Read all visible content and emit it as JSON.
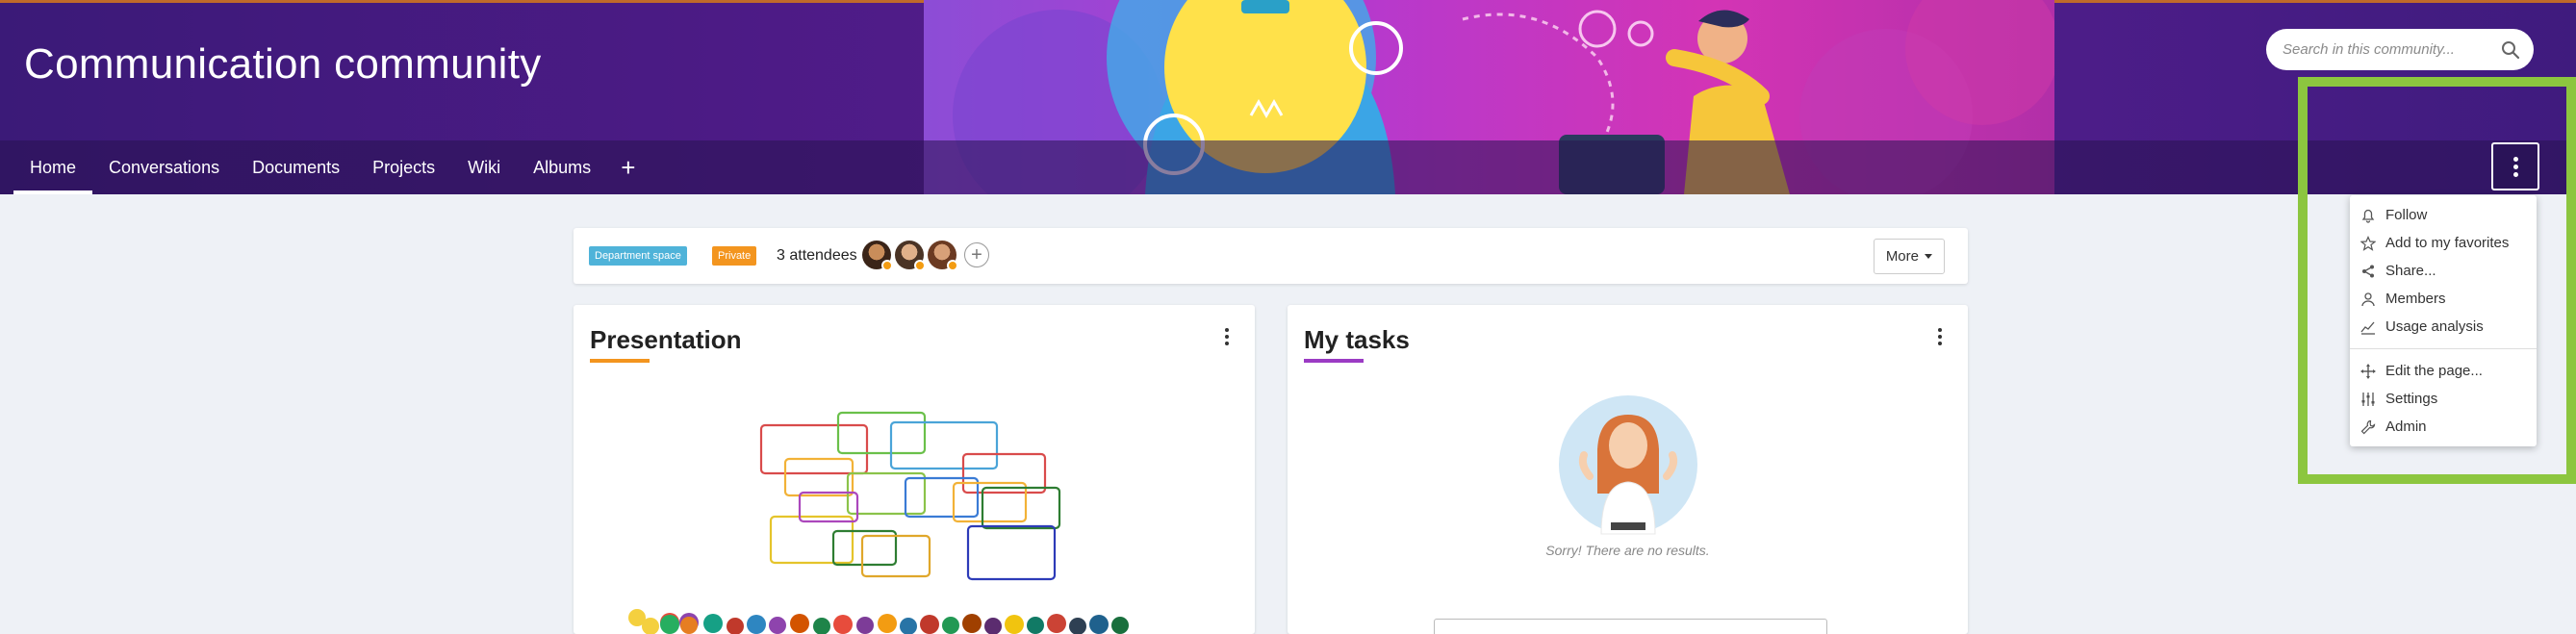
{
  "community": {
    "title": "Communication community"
  },
  "search": {
    "placeholder": "Search in this community..."
  },
  "nav": {
    "tabs": [
      {
        "label": "Home",
        "active": true
      },
      {
        "label": "Conversations",
        "active": false
      },
      {
        "label": "Documents",
        "active": false
      },
      {
        "label": "Projects",
        "active": false
      },
      {
        "label": "Wiki",
        "active": false
      },
      {
        "label": "Albums",
        "active": false
      }
    ],
    "add_icon": "plus-icon"
  },
  "menu": {
    "items": [
      {
        "label": "Follow",
        "icon": "bell-icon"
      },
      {
        "label": "Add to my favorites",
        "icon": "star-icon"
      },
      {
        "label": "Share...",
        "icon": "share-icon"
      },
      {
        "label": "Members",
        "icon": "person-icon"
      },
      {
        "label": "Usage analysis",
        "icon": "chart-icon"
      },
      {
        "label": "Edit the page...",
        "icon": "move-icon"
      },
      {
        "label": "Settings",
        "icon": "sliders-icon"
      },
      {
        "label": "Admin",
        "icon": "wrench-icon"
      }
    ]
  },
  "info": {
    "badge_department": "Department space",
    "badge_private": "Private",
    "attendees": "3 attendees",
    "more_label": "More"
  },
  "cards": {
    "presentation_title": "Presentation",
    "tasks_title": "My tasks",
    "no_results": "Sorry! There are no results."
  },
  "colors": {
    "accent_green": "#8cc63f",
    "banner_purple": "#4d1b86",
    "badge_blue": "#4fb3d9",
    "badge_orange": "#f3951f",
    "presentation_underline": "#f3951f",
    "tasks_underline": "#9b3bc4"
  }
}
